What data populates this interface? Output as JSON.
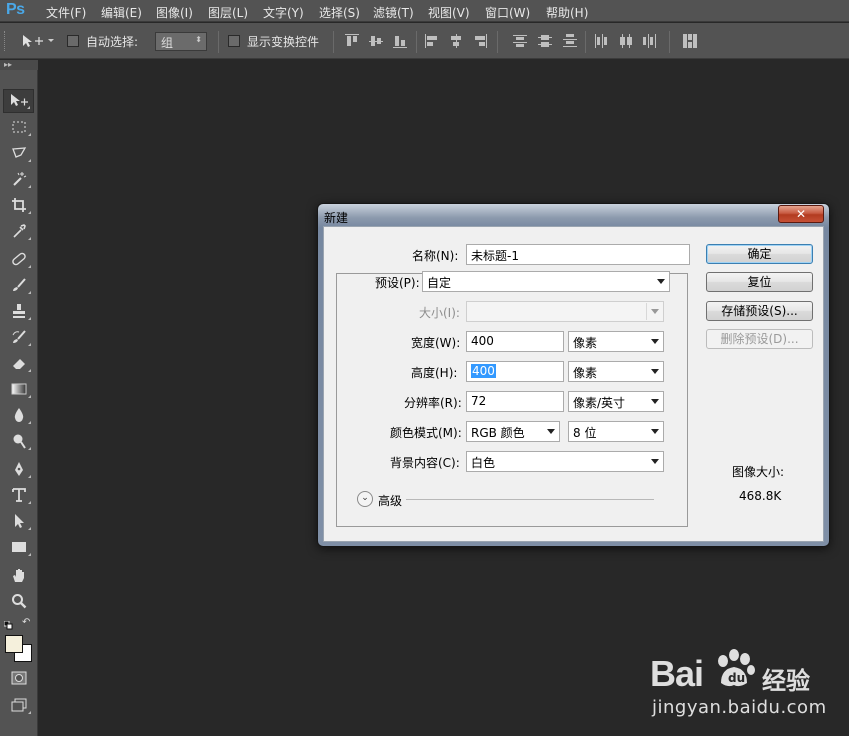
{
  "app": {
    "logo": "Ps"
  },
  "menu": [
    "文件(F)",
    "编辑(E)",
    "图像(I)",
    "图层(L)",
    "文字(Y)",
    "选择(S)",
    "滤镜(T)",
    "视图(V)",
    "窗口(W)",
    "帮助(H)"
  ],
  "options_bar": {
    "auto_select_label": "自动选择:",
    "auto_select_value": "组",
    "show_transform_label": "显示变换控件"
  },
  "toolbar": {
    "collapse_glyph": "▸▸"
  },
  "dialog": {
    "title": "新建",
    "close_glyph": "✕",
    "name_label": "名称(N):",
    "name_value": "未标题-1",
    "preset_label": "预设(P):",
    "preset_value": "自定",
    "size_label": "大小(I):",
    "size_value": "",
    "width_label": "宽度(W):",
    "width_value": "400",
    "width_unit": "像素",
    "height_label": "高度(H):",
    "height_value": "400",
    "height_unit": "像素",
    "resolution_label": "分辨率(R):",
    "resolution_value": "72",
    "resolution_unit": "像素/英寸",
    "color_mode_label": "颜色模式(M):",
    "color_mode_value": "RGB 颜色",
    "bit_depth_value": "8 位",
    "background_label": "背景内容(C):",
    "background_value": "白色",
    "advanced_label": "高级",
    "ok_button": "确定",
    "reset_button": "复位",
    "save_preset_button": "存储预设(S)...",
    "delete_preset_button": "删除预设(D)...",
    "image_size_label": "图像大小:",
    "image_size_value": "468.8K"
  },
  "watermark": {
    "brand_text": "Bai",
    "brand_suffix": "经验",
    "url": "jingyan.baidu.com"
  },
  "colors": {
    "foreground": "#f5f0dc",
    "background": "#ffffff",
    "canvas": "#282828",
    "chrome": "#535353"
  }
}
